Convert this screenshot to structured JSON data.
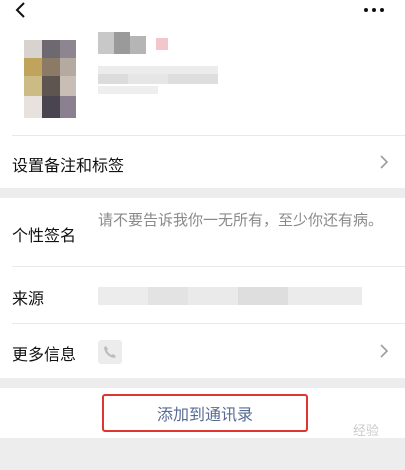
{
  "header": {
    "back_icon": "chevron-left-icon",
    "more_icon": "more-dots-icon"
  },
  "rows": {
    "remarks_label": "设置备注和标签",
    "signature_label": "个性签名",
    "signature_value": "请不要告诉我你一无所有，至少你还有病。",
    "source_label": "来源",
    "more_label": "更多信息",
    "more_icon": "phone-icon"
  },
  "actions": {
    "add_contact_label": "添加到通讯录",
    "highlight_color": "#e0342e",
    "label_color": "#576b95"
  },
  "watermark": "经验"
}
